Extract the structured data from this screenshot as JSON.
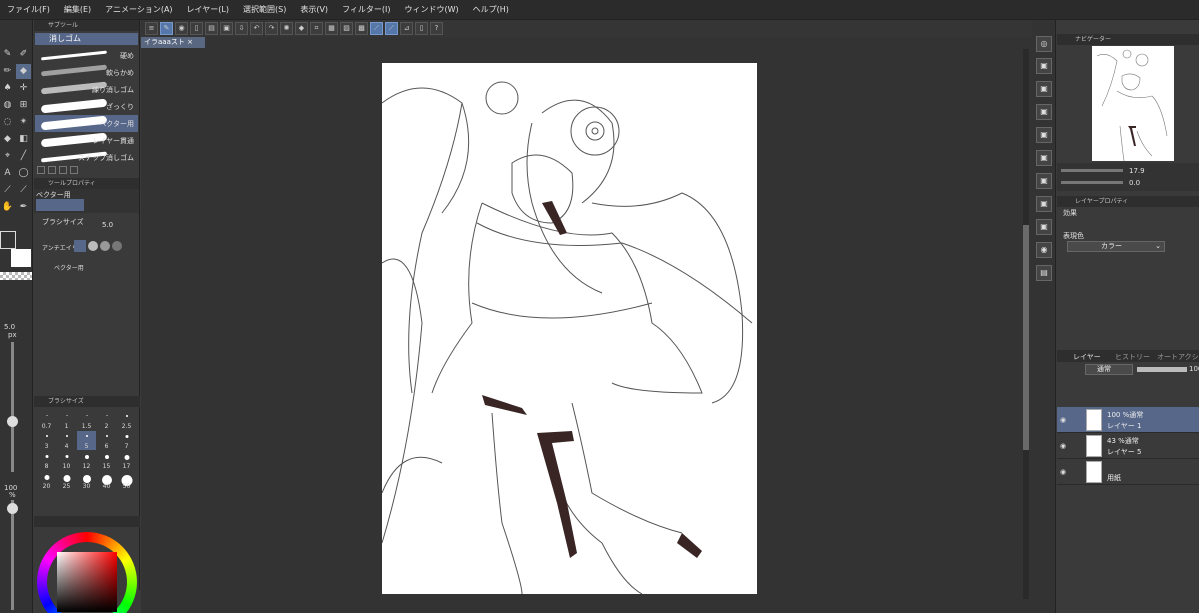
{
  "menu": [
    "ファイル(F)",
    "編集(E)",
    "アニメーション(A)",
    "レイヤー(L)",
    "選択範囲(S)",
    "表示(V)",
    "フィルター(I)",
    "ウィンドウ(W)",
    "ヘルプ(H)"
  ],
  "subtool": {
    "panel_title": "サブツール",
    "group_label": "消しゴム",
    "brushes": [
      {
        "label": "硬め",
        "selected": false
      },
      {
        "label": "軟らかめ",
        "selected": false
      },
      {
        "label": "練り消しゴム",
        "selected": false
      },
      {
        "label": "ざっくり",
        "selected": false
      },
      {
        "label": "ベクター用",
        "selected": true
      },
      {
        "label": "レイヤー貫通",
        "selected": false
      },
      {
        "label": "スナップ消しゴム",
        "selected": false
      }
    ]
  },
  "tool_property": {
    "panel_title": "ツールプロパティ",
    "preview_label": "ベクター用",
    "brush_size_label": "ブラシサイズ",
    "brush_size_value": "5.0",
    "antialias_label": "アンチエイリ",
    "vector_label": "ベクター用"
  },
  "brush_size_panel": {
    "title": "ブラシサイズ",
    "sizes": [
      "0.7",
      "1",
      "1.5",
      "2",
      "2.5",
      "3",
      "4",
      "5",
      "6",
      "7",
      "8",
      "10",
      "12",
      "15",
      "17",
      "20",
      "25",
      "30",
      "40",
      "50"
    ],
    "selected": "5"
  },
  "left_slider": {
    "size_value": "5.0",
    "size_unit": "px",
    "opacity_value": "100",
    "opacity_unit": "%"
  },
  "document": {
    "tab_label": "イラaaaスト"
  },
  "navigator": {
    "title": "ナビゲーター",
    "zoom": "17.9",
    "rotation": "0.0"
  },
  "layer_property": {
    "title": "レイヤープロパティ",
    "effect_label": "効果",
    "expression_label": "表現色",
    "expression_value": "カラー"
  },
  "layers_panel": {
    "tab_layer": "レイヤー",
    "tab_history": "ヒストリー",
    "tab_auto": "オートアクション",
    "blend_mode": "通常",
    "opacity": "100",
    "layers": [
      {
        "top": "100 %通常",
        "name": "レイヤー 1",
        "selected": true
      },
      {
        "top": "43 %通常",
        "name": "レイヤー 5",
        "selected": false
      },
      {
        "top": "",
        "name": "用紙",
        "selected": false
      }
    ]
  },
  "accent_color": "#56678a",
  "icons": [
    "pen-icon",
    "eraser-icon",
    "fill-icon",
    "text-icon",
    "hand-icon",
    "eyedropper-icon",
    "undo-icon",
    "redo-icon",
    "eye-icon"
  ]
}
